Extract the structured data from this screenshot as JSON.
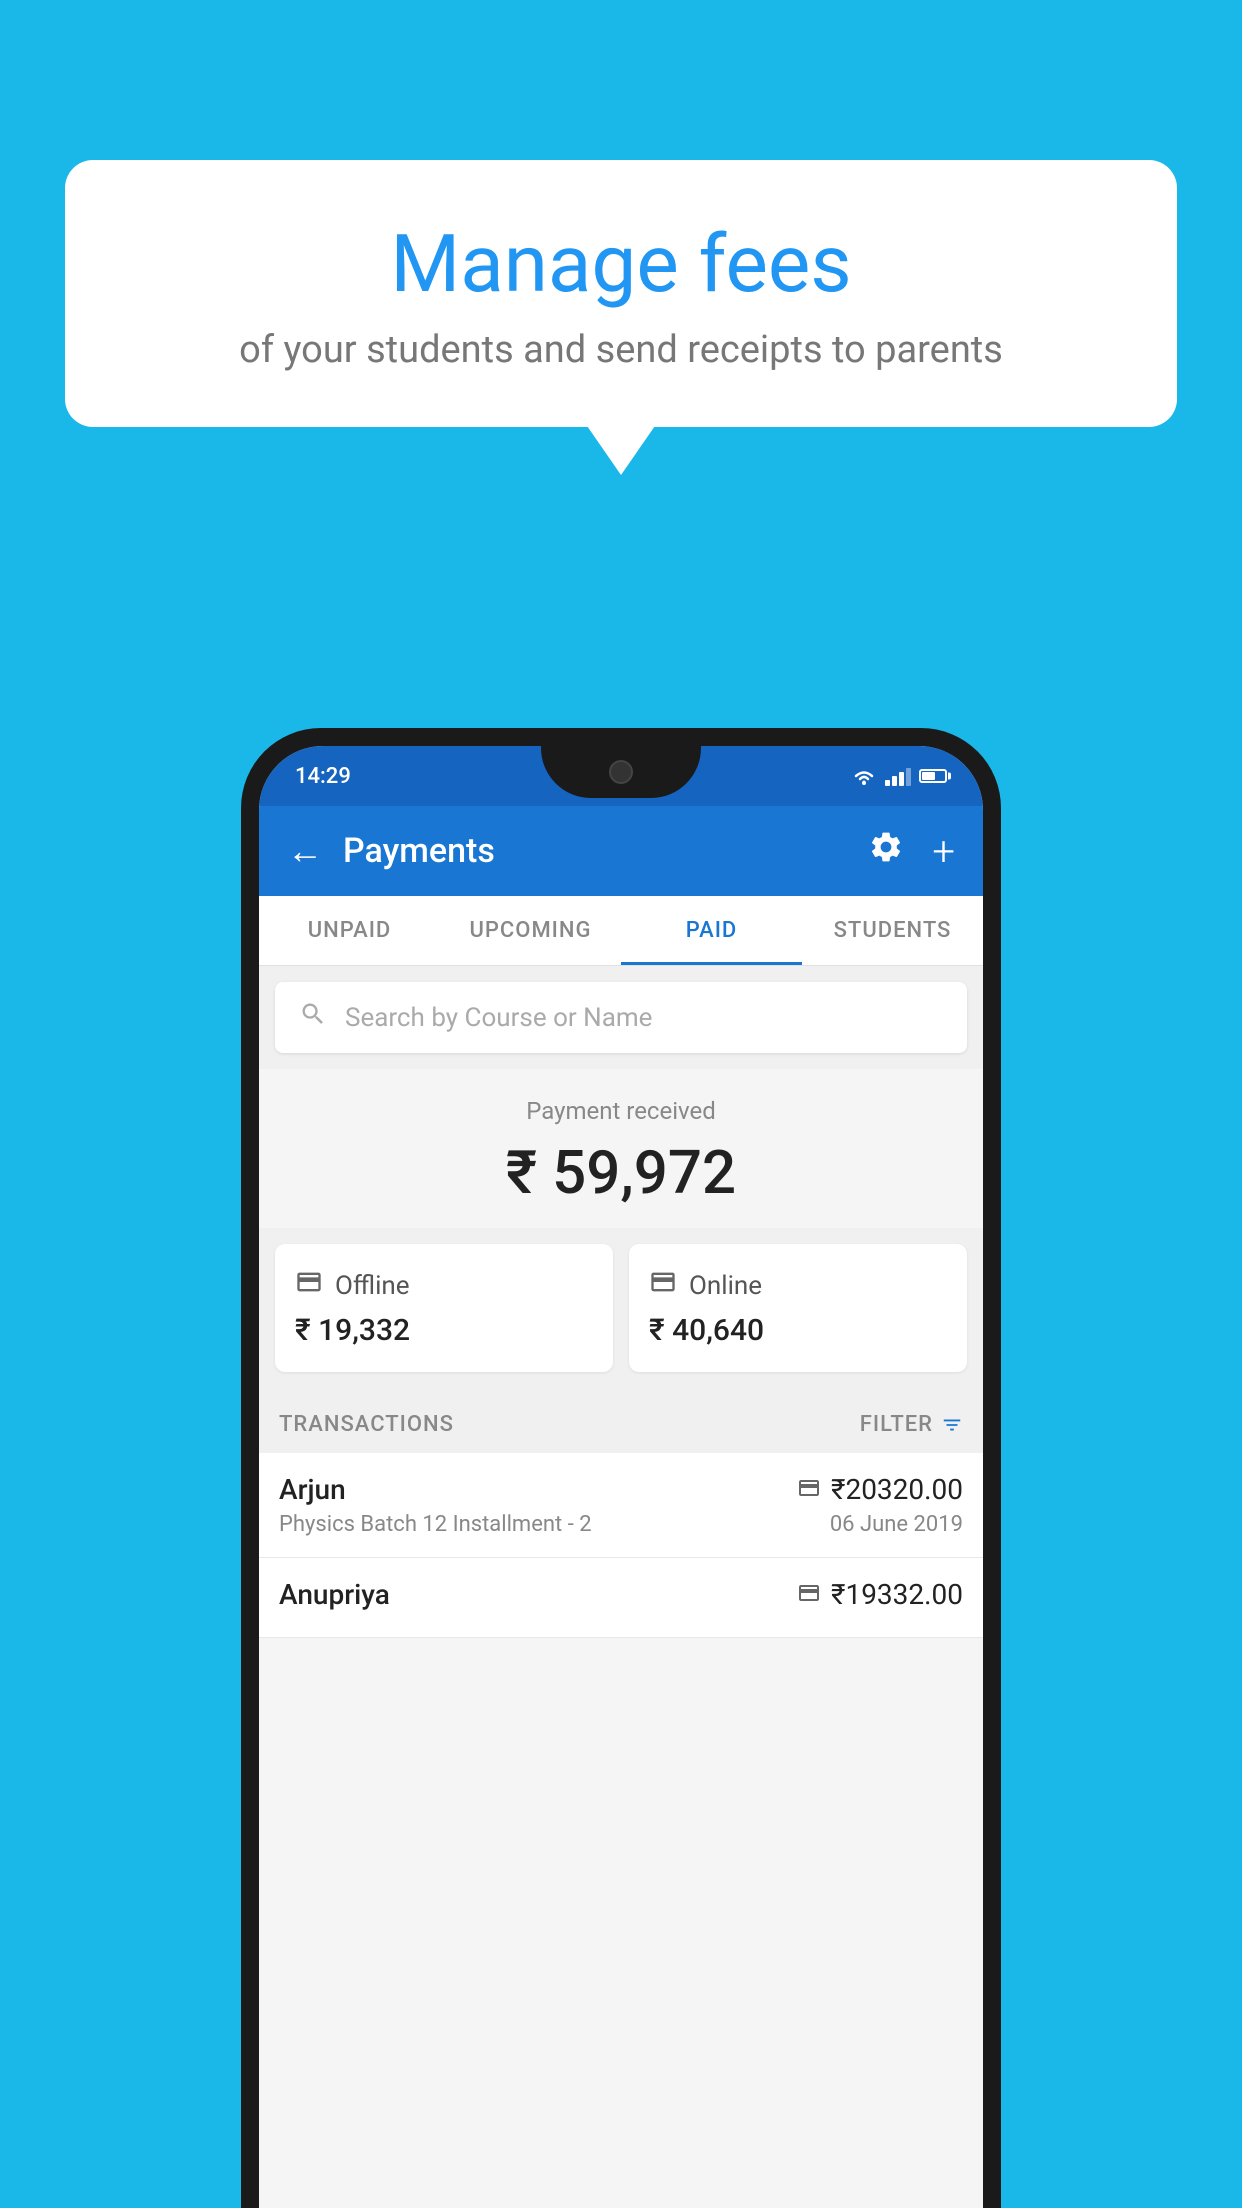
{
  "background_color": "#1ab8e8",
  "speech_bubble": {
    "title": "Manage fees",
    "subtitle": "of your students and send receipts to parents"
  },
  "status_bar": {
    "time": "14:29"
  },
  "app_bar": {
    "title": "Payments",
    "back_label": "←",
    "settings_label": "⚙",
    "add_label": "+"
  },
  "tabs": [
    {
      "id": "unpaid",
      "label": "UNPAID",
      "active": false
    },
    {
      "id": "upcoming",
      "label": "UPCOMING",
      "active": false
    },
    {
      "id": "paid",
      "label": "PAID",
      "active": true
    },
    {
      "id": "students",
      "label": "STUDENTS",
      "active": false
    }
  ],
  "search": {
    "placeholder": "Search by Course or Name"
  },
  "payment_received": {
    "label": "Payment received",
    "amount": "₹ 59,972"
  },
  "payment_cards": [
    {
      "icon": "💳",
      "label": "Offline",
      "amount": "₹ 19,332"
    },
    {
      "icon": "🏧",
      "label": "Online",
      "amount": "₹ 40,640"
    }
  ],
  "transactions_section": {
    "label": "TRANSACTIONS",
    "filter_label": "FILTER"
  },
  "transactions": [
    {
      "name": "Arjun",
      "type_icon": "🏧",
      "amount": "₹20320.00",
      "description": "Physics Batch 12 Installment - 2",
      "date": "06 June 2019"
    },
    {
      "name": "Anupriya",
      "type_icon": "💳",
      "amount": "₹19332.00",
      "description": "",
      "date": ""
    }
  ]
}
